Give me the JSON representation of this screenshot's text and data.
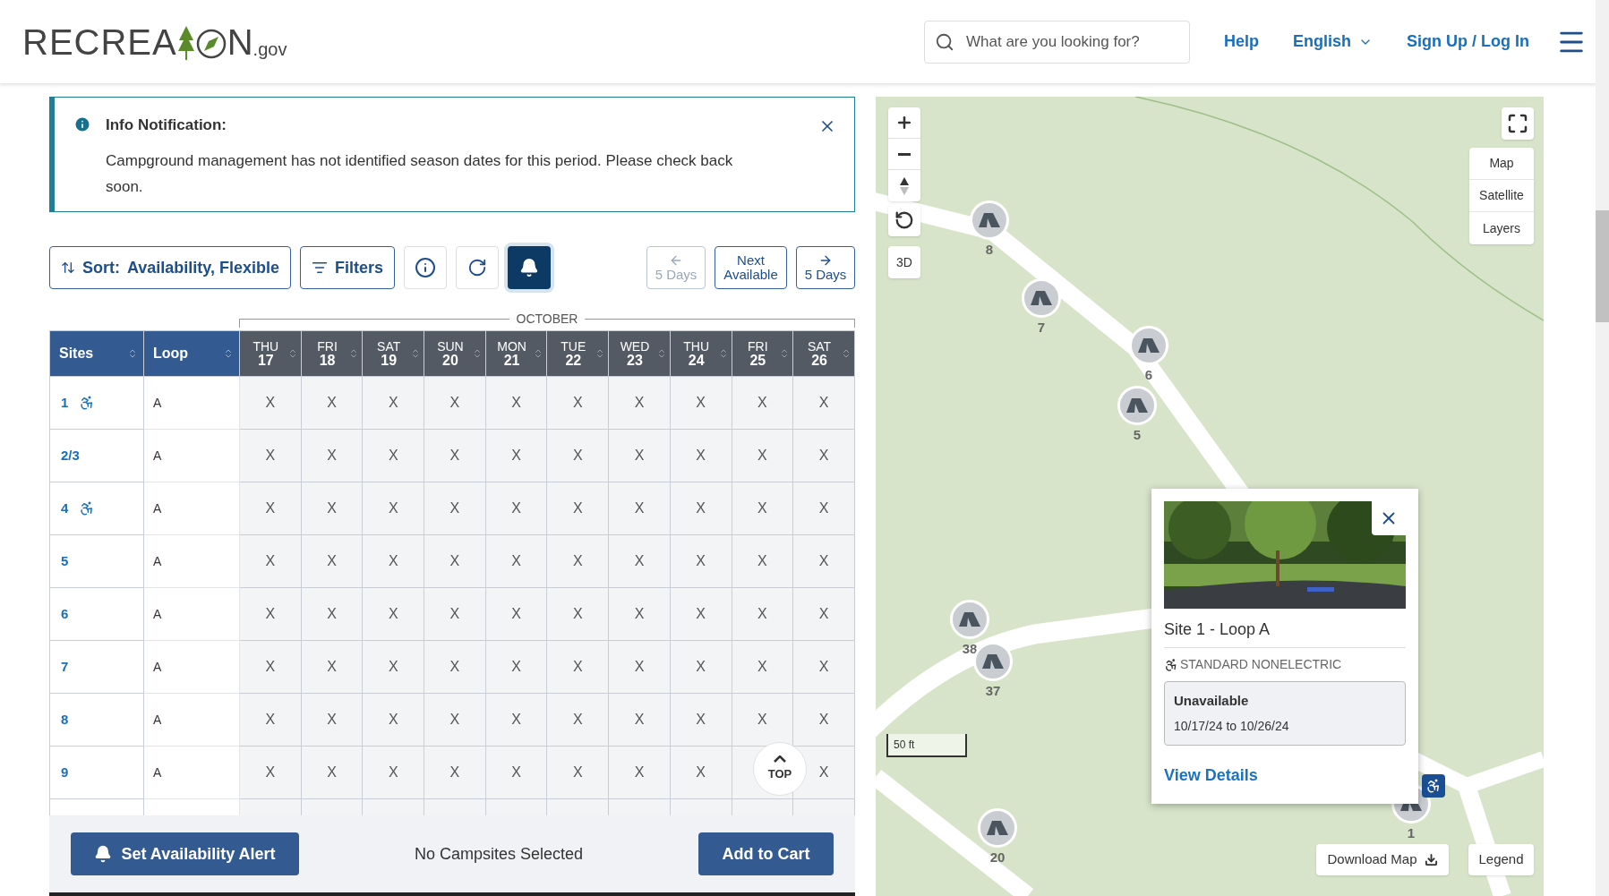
{
  "header": {
    "logo": {
      "lead": "RECREA",
      "tail": "N",
      "suffix": ".gov"
    },
    "search": {
      "placeholder": "What are you looking for?"
    },
    "nav": [
      {
        "label": "Help",
        "kind": "link"
      },
      {
        "label": "English",
        "kind": "dropdown"
      },
      {
        "label": "Sign Up / Log In",
        "kind": "link"
      }
    ]
  },
  "notification": {
    "title": "Info Notification:",
    "message": "Campground management has not identified season dates for this period. Please check back soon."
  },
  "toolbar": {
    "sort_label": "Sort:",
    "sort_value": "Availability, Flexible",
    "filters": "Filters",
    "alerts_on": true,
    "paging": [
      {
        "label": "5 Days",
        "kind": "back",
        "disabled": true
      },
      {
        "label": "Next Available",
        "kind": "next",
        "disabled": false
      },
      {
        "label": "5 Days",
        "kind": "forward",
        "disabled": false
      }
    ]
  },
  "table": {
    "month": "OCTOBER",
    "columns": [
      {
        "label": "Sites"
      },
      {
        "label": "Loop"
      }
    ],
    "days": [
      {
        "dow": "THU",
        "day": "17"
      },
      {
        "dow": "FRI",
        "day": "18"
      },
      {
        "dow": "SAT",
        "day": "19"
      },
      {
        "dow": "SUN",
        "day": "20"
      },
      {
        "dow": "MON",
        "day": "21"
      },
      {
        "dow": "TUE",
        "day": "22"
      },
      {
        "dow": "WED",
        "day": "23"
      },
      {
        "dow": "THU",
        "day": "24"
      },
      {
        "dow": "FRI",
        "day": "25"
      },
      {
        "dow": "SAT",
        "day": "26"
      }
    ],
    "rows": [
      {
        "site": "1",
        "accessible": true,
        "loop": "A",
        "cells": [
          "X",
          "X",
          "X",
          "X",
          "X",
          "X",
          "X",
          "X",
          "X",
          "X"
        ]
      },
      {
        "site": "2/3",
        "accessible": false,
        "loop": "A",
        "cells": [
          "X",
          "X",
          "X",
          "X",
          "X",
          "X",
          "X",
          "X",
          "X",
          "X"
        ]
      },
      {
        "site": "4",
        "accessible": true,
        "loop": "A",
        "cells": [
          "X",
          "X",
          "X",
          "X",
          "X",
          "X",
          "X",
          "X",
          "X",
          "X"
        ]
      },
      {
        "site": "5",
        "accessible": false,
        "loop": "A",
        "cells": [
          "X",
          "X",
          "X",
          "X",
          "X",
          "X",
          "X",
          "X",
          "X",
          "X"
        ]
      },
      {
        "site": "6",
        "accessible": false,
        "loop": "A",
        "cells": [
          "X",
          "X",
          "X",
          "X",
          "X",
          "X",
          "X",
          "X",
          "X",
          "X"
        ]
      },
      {
        "site": "7",
        "accessible": false,
        "loop": "A",
        "cells": [
          "X",
          "X",
          "X",
          "X",
          "X",
          "X",
          "X",
          "X",
          "X",
          "X"
        ]
      },
      {
        "site": "8",
        "accessible": false,
        "loop": "A",
        "cells": [
          "X",
          "X",
          "X",
          "X",
          "X",
          "X",
          "X",
          "X",
          "X",
          "X"
        ]
      },
      {
        "site": "9",
        "accessible": false,
        "loop": "A",
        "cells": [
          "X",
          "X",
          "X",
          "X",
          "X",
          "X",
          "X",
          "X",
          null,
          "X"
        ]
      }
    ]
  },
  "top_button": "TOP",
  "footer": {
    "alert_button": "Set Availability Alert",
    "status": "No Campsites Selected",
    "cart_button": "Add to Cart"
  },
  "map": {
    "three_d": "3D",
    "layers": [
      {
        "label": "Map"
      },
      {
        "label": "Satellite"
      },
      {
        "label": "Layers"
      }
    ],
    "markers": [
      {
        "label": "8"
      },
      {
        "label": "7"
      },
      {
        "label": "6"
      },
      {
        "label": "5"
      },
      {
        "label": "38"
      },
      {
        "label": "37"
      },
      {
        "label": "20"
      },
      {
        "label": "1"
      }
    ],
    "scale": "50 ft",
    "download": "Download Map",
    "legend": "Legend",
    "popup": {
      "title": "Site 1 - Loop A",
      "type": "STANDARD NONELECTRIC",
      "accessible": true,
      "status": "Unavailable",
      "dates": "10/17/24 to 10/26/24",
      "link": "View Details"
    }
  }
}
